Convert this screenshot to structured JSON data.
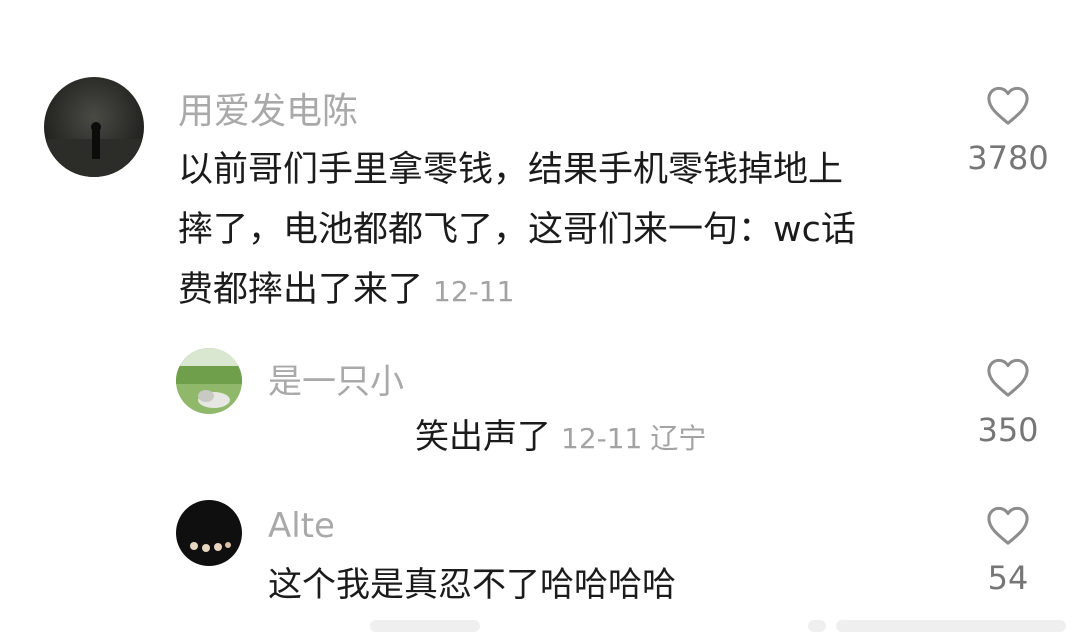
{
  "comments": [
    {
      "username": "用爱发电陈",
      "lines": [
        "以前哥们手里拿零钱，结果手机零钱掉地上",
        "摔了，电池都都飞了，这哥们来一句：wc话",
        "费都摔出了来了"
      ],
      "time": "12-11",
      "location": "",
      "likes": "3780",
      "avatar": "dark-landscape-avatar"
    },
    {
      "username": "是一只小",
      "lines": [
        "笑出声了"
      ],
      "time": "12-11",
      "location": "辽宁",
      "likes": "350",
      "avatar": "green-field-avatar"
    },
    {
      "username": "Alte",
      "lines": [
        "这个我是真忍不了哈哈哈哈"
      ],
      "time": "",
      "location": "",
      "likes": "54",
      "avatar": "dark-avatar"
    }
  ],
  "icons": {
    "like": "heart-outline-icon"
  },
  "colors": {
    "username": "#a9a9a9",
    "body": "#1b1b1b",
    "meta": "#a3a3a3",
    "likes": "#767676"
  }
}
